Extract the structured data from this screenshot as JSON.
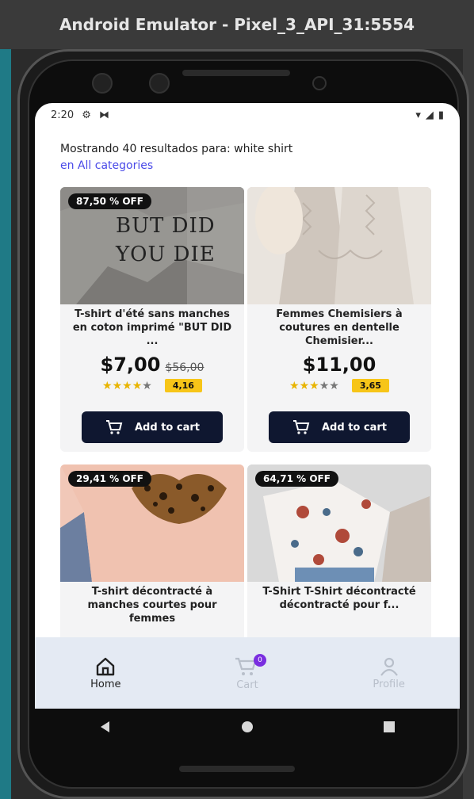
{
  "window": {
    "title": "Android Emulator - Pixel_3_API_31:5554"
  },
  "statusbar": {
    "time": "2:20",
    "icons_left": [
      "gear-icon",
      "media-icon"
    ],
    "icons_right": [
      "wifi-icon",
      "signal-icon",
      "battery-icon"
    ]
  },
  "search": {
    "results_text": "Mostrando 40 resultados para: white shirt",
    "category_link": "en All categories"
  },
  "products": [
    {
      "badge": "87,50 % OFF",
      "image_text_1": "BUT DID",
      "image_text_2": "YOU DIE",
      "title": "T-shirt d'été sans manches en coton imprimé \"BUT DID ...",
      "price": "$7,00",
      "old_price": "$56,00",
      "rating": "4,16",
      "stars": 4,
      "button": "Add to cart"
    },
    {
      "badge": "",
      "title": "Femmes Chemisiers à coutures en dentelle Chemisier...",
      "price": "$11,00",
      "old_price": "",
      "rating": "3,65",
      "stars": 3,
      "button": "Add to cart"
    },
    {
      "badge": "29,41 % OFF",
      "title": "T-shirt décontracté à manches courtes pour femmes"
    },
    {
      "badge": "64,71 % OFF",
      "title": "T-Shirt T-Shirt décontracté décontracté pour f..."
    }
  ],
  "nav": {
    "home": "Home",
    "cart": "Cart",
    "profile": "Profile",
    "cart_count": "0"
  },
  "colors": {
    "accent": "#0f1730",
    "link": "#4a4ae8",
    "rating": "#f7c518",
    "badge_purple": "#7a2ee0"
  }
}
